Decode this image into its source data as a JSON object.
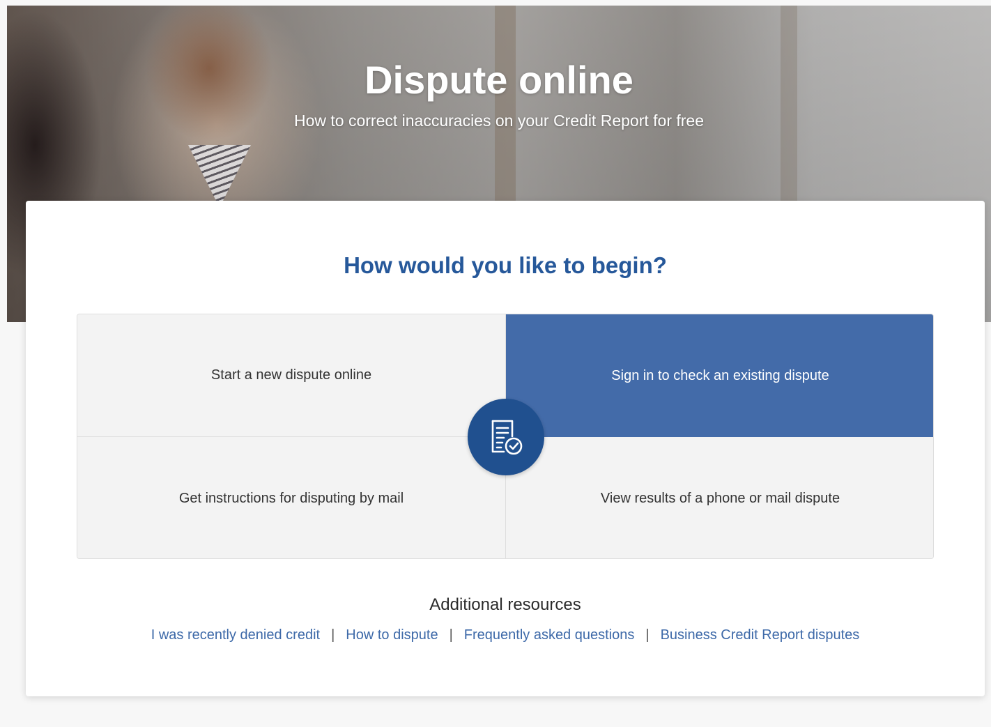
{
  "hero": {
    "title": "Dispute online",
    "subtitle": "How to correct inaccuracies on your Credit Report for free"
  },
  "card": {
    "heading": "How would you like to begin?",
    "options": [
      {
        "label": "Start a new dispute online",
        "selected": false
      },
      {
        "label": "Sign in to check an existing dispute",
        "selected": true
      },
      {
        "label": "Get instructions for disputing by mail",
        "selected": false
      },
      {
        "label": "View results of a phone or mail dispute",
        "selected": false
      }
    ],
    "center_icon": "document-check-icon"
  },
  "resources": {
    "title": "Additional resources",
    "links": [
      "I was recently denied credit",
      "How to dispute",
      "Frequently asked questions",
      "Business Credit Report disputes"
    ],
    "separator": "|"
  },
  "colors": {
    "primary_blue": "#20508f",
    "selected_tile": "#436ba9",
    "heading_blue": "#26589a",
    "link_blue": "#3d69a8",
    "tile_bg": "#f3f3f3"
  }
}
